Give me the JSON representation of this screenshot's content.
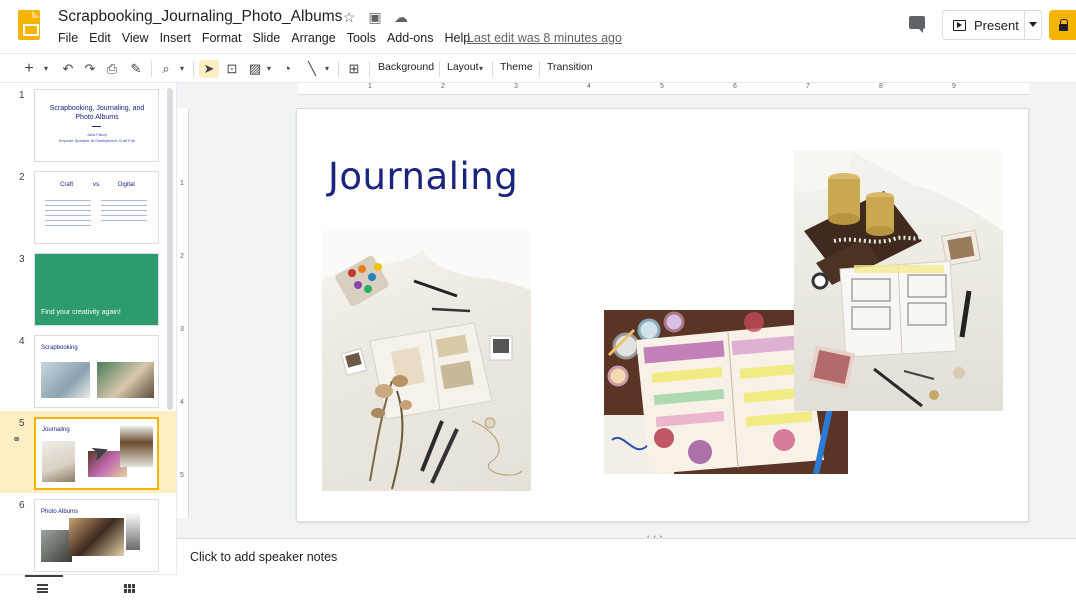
{
  "app": {
    "title": "Scrapbooking_Journaling_Photo_Albums",
    "last_edit": "Last edit was 8 minutes ago",
    "menu": [
      "File",
      "Edit",
      "View",
      "Insert",
      "Format",
      "Slide",
      "Arrange",
      "Tools",
      "Add-ons",
      "Help"
    ],
    "present_label": "Present",
    "accent_color": "#f4b400"
  },
  "toolbar": {
    "background_label": "Background",
    "layout_label": "Layout",
    "theme_label": "Theme",
    "transition_label": "Transition"
  },
  "ruler": {
    "h_ticks": [
      "1",
      "2",
      "3",
      "4",
      "5",
      "6",
      "7",
      "8",
      "9"
    ],
    "v_ticks": [
      "1",
      "2",
      "3",
      "4",
      "5"
    ]
  },
  "slides": [
    {
      "num": "1",
      "title": "Scrapbooking, Journaling, and Photo Albums",
      "sub1": "Julia Fillory",
      "sub2": "Keynote Speaker at Shelbyfield's Craft Fair"
    },
    {
      "num": "2",
      "col1": "Craft",
      "vs": "vs.",
      "col2": "Digital"
    },
    {
      "num": "3",
      "title": "Find your creativity again!",
      "bg": "#2e9b6f"
    },
    {
      "num": "4",
      "title": "Scrapbooking"
    },
    {
      "num": "5",
      "title": "Journaling"
    },
    {
      "num": "6",
      "title": "Photo Albums"
    }
  ],
  "current_slide": {
    "title": "Journaling",
    "title_color": "#1a237e"
  },
  "notes": {
    "placeholder": "Click to add speaker notes"
  }
}
